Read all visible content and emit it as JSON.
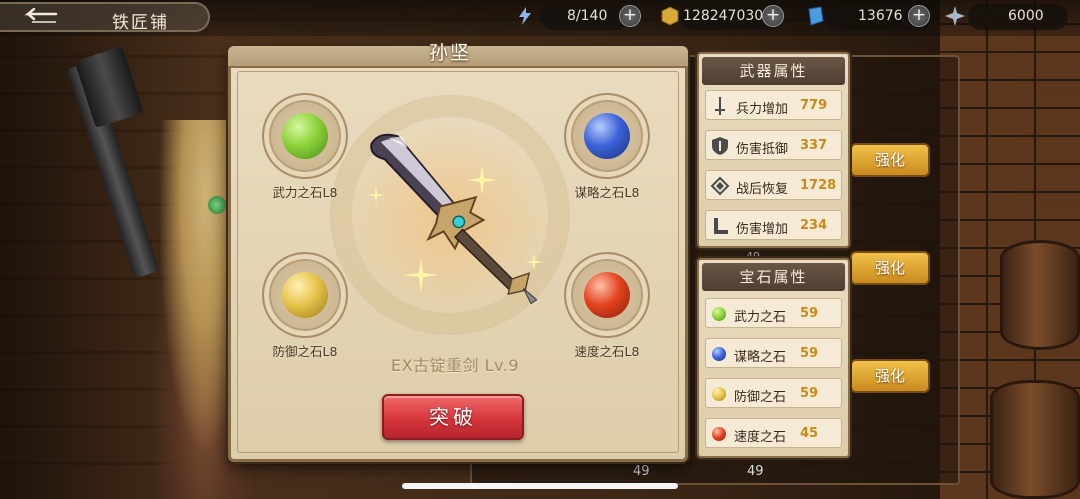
{
  "topbar": {
    "title": "铁匠铺",
    "energy": "8/140",
    "gold": "128247030",
    "gems": "13676",
    "crystal": "6000",
    "icons": {
      "back": "back-arrow-icon",
      "energy": "lightning-icon",
      "gold": "gold-coin-icon",
      "gems": "blue-crystal-icon",
      "crystal": "star-crystal-icon",
      "plus": "plus-icon"
    }
  },
  "panel": {
    "title": "孙坚",
    "weapon_name": "EX古锭重剑 Lv.9",
    "break_button": "突破",
    "slots": [
      {
        "label": "武力之石L8",
        "color": "#8bd23a"
      },
      {
        "label": "谋略之石L8",
        "color": "#3a62d8"
      },
      {
        "label": "防御之石L8",
        "color": "#e7c34a"
      },
      {
        "label": "速度之石L8",
        "color": "#e2431f"
      }
    ]
  },
  "weapon_attrs": {
    "title": "武器属性",
    "rows": [
      {
        "name": "兵力增加",
        "value": "779",
        "icon": "sword-icon"
      },
      {
        "name": "伤害抵御",
        "value": "337",
        "icon": "shield-icon"
      },
      {
        "name": "战后恢复",
        "value": "1728",
        "icon": "heal-icon"
      },
      {
        "name": "伤害增加",
        "value": "234",
        "icon": "damage-icon"
      }
    ]
  },
  "gem_attrs": {
    "title": "宝石属性",
    "rows": [
      {
        "name": "武力之石",
        "value": "59",
        "color": "#8bd23a"
      },
      {
        "name": "谋略之石",
        "value": "59",
        "color": "#3a62d8"
      },
      {
        "name": "防御之石",
        "value": "59",
        "color": "#e7c34a"
      },
      {
        "name": "速度之石",
        "value": "45",
        "color": "#e2431f"
      }
    ]
  },
  "background": {
    "enhance_label": "强化",
    "counts": [
      "49",
      "49",
      "49",
      "49"
    ]
  }
}
